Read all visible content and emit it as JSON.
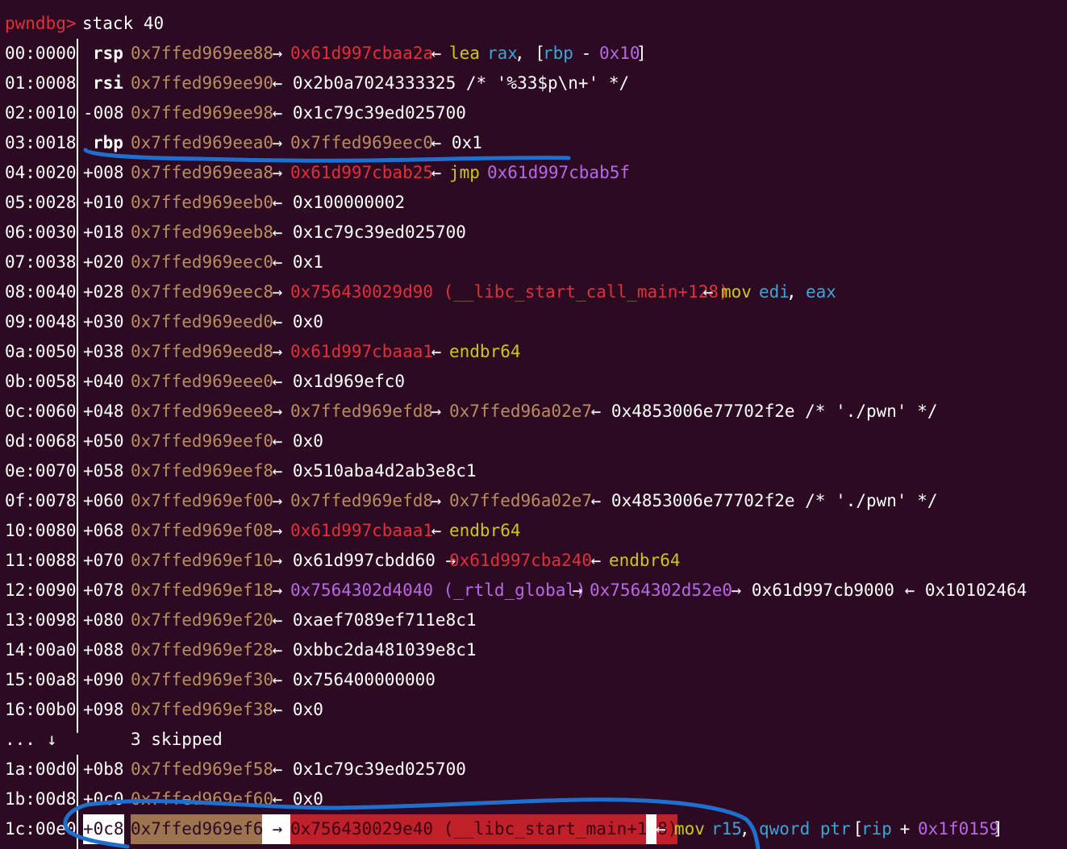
{
  "terminal": {
    "prompt": "pwndbg>",
    "command": "stack 40",
    "skipped": {
      "dots": "...",
      "arrow": "↓",
      "text": "3 skipped"
    },
    "colors": {
      "background": "#2c0a22",
      "prompt": "#e0303a",
      "stack_addr": "#b98d62",
      "code_ptr": "#e0303a",
      "instruction": "#c8c820",
      "register": "#3ea4d8",
      "data_ptr": "#b768e8",
      "annotation": "#1f6fd0"
    },
    "rows": [
      {
        "idx": "00:0000",
        "off": "rsp",
        "off_bold": true,
        "parts": [
          {
            "t": "0x7ffed969ee88",
            "c": "brown"
          },
          {
            "t": " → ",
            "c": "white"
          },
          {
            "t": "0x61d997cbaa2a",
            "c": "red"
          },
          {
            "t": " ← ",
            "c": "white"
          },
          {
            "t": "lea",
            "c": "yellow"
          },
          {
            "t": " ",
            "c": "white"
          },
          {
            "t": "rax",
            "c": "blue"
          },
          {
            "t": ", [",
            "c": "white"
          },
          {
            "t": "rbp",
            "c": "blue"
          },
          {
            "t": " - ",
            "c": "white"
          },
          {
            "t": "0x10",
            "c": "purple"
          },
          {
            "t": "]",
            "c": "white"
          }
        ]
      },
      {
        "idx": "01:0008",
        "off": "rsi",
        "off_bold": true,
        "parts": [
          {
            "t": "0x7ffed969ee90",
            "c": "brown"
          },
          {
            "t": " ← 0x2b0a7024333325 /* '%33$p\\n+' */",
            "c": "white"
          }
        ]
      },
      {
        "idx": "02:0010",
        "off": "-008",
        "parts": [
          {
            "t": "0x7ffed969ee98",
            "c": "brown"
          },
          {
            "t": " ← 0x1c79c39ed025700",
            "c": "white"
          }
        ]
      },
      {
        "idx": "03:0018",
        "off": "rbp",
        "off_bold": true,
        "parts": [
          {
            "t": "0x7ffed969eea0",
            "c": "brown"
          },
          {
            "t": " → ",
            "c": "white"
          },
          {
            "t": "0x7ffed969eec0",
            "c": "brown"
          },
          {
            "t": " ← 0x1",
            "c": "white"
          }
        ]
      },
      {
        "idx": "04:0020",
        "off": "+008",
        "parts": [
          {
            "t": "0x7ffed969eea8",
            "c": "brown"
          },
          {
            "t": " → ",
            "c": "white"
          },
          {
            "t": "0x61d997cbab25",
            "c": "red"
          },
          {
            "t": " ← ",
            "c": "white"
          },
          {
            "t": "jmp",
            "c": "yellow"
          },
          {
            "t": " ",
            "c": "white"
          },
          {
            "t": "0x61d997cbab5f",
            "c": "purple"
          }
        ]
      },
      {
        "idx": "05:0028",
        "off": "+010",
        "parts": [
          {
            "t": "0x7ffed969eeb0",
            "c": "brown"
          },
          {
            "t": " ← 0x100000002",
            "c": "white"
          }
        ]
      },
      {
        "idx": "06:0030",
        "off": "+018",
        "parts": [
          {
            "t": "0x7ffed969eeb8",
            "c": "brown"
          },
          {
            "t": " ← 0x1c79c39ed025700",
            "c": "white"
          }
        ]
      },
      {
        "idx": "07:0038",
        "off": "+020",
        "parts": [
          {
            "t": "0x7ffed969eec0",
            "c": "brown"
          },
          {
            "t": " ← 0x1",
            "c": "white"
          }
        ]
      },
      {
        "idx": "08:0040",
        "off": "+028",
        "parts": [
          {
            "t": "0x7ffed969eec8",
            "c": "brown"
          },
          {
            "t": " → ",
            "c": "white"
          },
          {
            "t": "0x756430029d90 (__libc_start_call_main+128)",
            "c": "red"
          },
          {
            "t": " ← ",
            "c": "white"
          },
          {
            "t": "mov",
            "c": "yellow"
          },
          {
            "t": " ",
            "c": "white"
          },
          {
            "t": "edi",
            "c": "blue"
          },
          {
            "t": ", ",
            "c": "white"
          },
          {
            "t": "eax",
            "c": "blue"
          }
        ]
      },
      {
        "idx": "09:0048",
        "off": "+030",
        "parts": [
          {
            "t": "0x7ffed969eed0",
            "c": "brown"
          },
          {
            "t": " ← 0x0",
            "c": "white"
          }
        ]
      },
      {
        "idx": "0a:0050",
        "off": "+038",
        "parts": [
          {
            "t": "0x7ffed969eed8",
            "c": "brown"
          },
          {
            "t": " → ",
            "c": "white"
          },
          {
            "t": "0x61d997cbaaa1",
            "c": "red"
          },
          {
            "t": " ← ",
            "c": "white"
          },
          {
            "t": "endbr64",
            "c": "yellow"
          }
        ]
      },
      {
        "idx": "0b:0058",
        "off": "+040",
        "parts": [
          {
            "t": "0x7ffed969eee0",
            "c": "brown"
          },
          {
            "t": " ← 0x1d969efc0",
            "c": "white"
          }
        ]
      },
      {
        "idx": "0c:0060",
        "off": "+048",
        "parts": [
          {
            "t": "0x7ffed969eee8",
            "c": "brown"
          },
          {
            "t": " → ",
            "c": "white"
          },
          {
            "t": "0x7ffed969efd8",
            "c": "brown"
          },
          {
            "t": " → ",
            "c": "white"
          },
          {
            "t": "0x7ffed96a02e7",
            "c": "brown"
          },
          {
            "t": " ← 0x4853006e77702f2e /* './pwn' */",
            "c": "white"
          }
        ]
      },
      {
        "idx": "0d:0068",
        "off": "+050",
        "parts": [
          {
            "t": "0x7ffed969eef0",
            "c": "brown"
          },
          {
            "t": " ← 0x0",
            "c": "white"
          }
        ]
      },
      {
        "idx": "0e:0070",
        "off": "+058",
        "parts": [
          {
            "t": "0x7ffed969eef8",
            "c": "brown"
          },
          {
            "t": " ← 0x510aba4d2ab3e8c1",
            "c": "white"
          }
        ]
      },
      {
        "idx": "0f:0078",
        "off": "+060",
        "parts": [
          {
            "t": "0x7ffed969ef00",
            "c": "brown"
          },
          {
            "t": " → ",
            "c": "white"
          },
          {
            "t": "0x7ffed969efd8",
            "c": "brown"
          },
          {
            "t": " → ",
            "c": "white"
          },
          {
            "t": "0x7ffed96a02e7",
            "c": "brown"
          },
          {
            "t": " ← 0x4853006e77702f2e /* './pwn' */",
            "c": "white"
          }
        ]
      },
      {
        "idx": "10:0080",
        "off": "+068",
        "parts": [
          {
            "t": "0x7ffed969ef08",
            "c": "brown"
          },
          {
            "t": " → ",
            "c": "white"
          },
          {
            "t": "0x61d997cbaaa1",
            "c": "red"
          },
          {
            "t": " ← ",
            "c": "white"
          },
          {
            "t": "endbr64",
            "c": "yellow"
          }
        ]
      },
      {
        "idx": "11:0088",
        "off": "+070",
        "parts": [
          {
            "t": "0x7ffed969ef10",
            "c": "brown"
          },
          {
            "t": " → 0x61d997cbdd60 → ",
            "c": "white"
          },
          {
            "t": "0x61d997cba240",
            "c": "red"
          },
          {
            "t": " ← ",
            "c": "white"
          },
          {
            "t": "endbr64",
            "c": "yellow"
          }
        ]
      },
      {
        "idx": "12:0090",
        "off": "+078",
        "parts": [
          {
            "t": "0x7ffed969ef18",
            "c": "brown"
          },
          {
            "t": " → ",
            "c": "white"
          },
          {
            "t": "0x7564302d4040 (_rtld_global)",
            "c": "purple"
          },
          {
            "t": " → ",
            "c": "white"
          },
          {
            "t": "0x7564302d52e0",
            "c": "purple"
          },
          {
            "t": " → 0x61d997cb9000 ← 0x10102464",
            "c": "white"
          }
        ]
      },
      {
        "idx": "13:0098",
        "off": "+080",
        "parts": [
          {
            "t": "0x7ffed969ef20",
            "c": "brown"
          },
          {
            "t": " ← 0xaef7089ef711e8c1",
            "c": "white"
          }
        ]
      },
      {
        "idx": "14:00a0",
        "off": "+088",
        "parts": [
          {
            "t": "0x7ffed969ef28",
            "c": "brown"
          },
          {
            "t": " ← 0xbbc2da481039e8c1",
            "c": "white"
          }
        ]
      },
      {
        "idx": "15:00a8",
        "off": "+090",
        "parts": [
          {
            "t": "0x7ffed969ef30",
            "c": "brown"
          },
          {
            "t": " ← 0x756400000000",
            "c": "white"
          }
        ]
      },
      {
        "idx": "16:00b0",
        "off": "+098",
        "parts": [
          {
            "t": "0x7ffed969ef38",
            "c": "brown"
          },
          {
            "t": " ← 0x0",
            "c": "white"
          }
        ]
      },
      {
        "skipped": true
      },
      {
        "idx": "1a:00d0",
        "off": "+0b8",
        "parts": [
          {
            "t": "0x7ffed969ef58",
            "c": "brown"
          },
          {
            "t": " ← 0x1c79c39ed025700",
            "c": "white"
          }
        ]
      },
      {
        "idx": "1b:00d8",
        "off": "+0c0",
        "parts": [
          {
            "t": "0x7ffed969ef60",
            "c": "brown"
          },
          {
            "t": " ← 0x0",
            "c": "white"
          }
        ]
      },
      {
        "idx": "1c:00e0",
        "off": "+0c8",
        "off_hl": "white",
        "parts": [
          {
            "t": "0x7ffed969ef68",
            "c": "hl-brown"
          },
          {
            "t": " → ",
            "c": "hl-white"
          },
          {
            "t": "0x756430029e40 (__libc_start_main+128)",
            "c": "hl-red"
          },
          {
            "t": " ",
            "c": "hl-white"
          },
          {
            "t": "← ",
            "c": "white"
          },
          {
            "t": "mov",
            "c": "yellow"
          },
          {
            "t": " ",
            "c": "white"
          },
          {
            "t": "r15",
            "c": "blue"
          },
          {
            "t": ", ",
            "c": "white"
          },
          {
            "t": "qword ptr",
            "c": "blue"
          },
          {
            "t": " [",
            "c": "white"
          },
          {
            "t": "rip",
            "c": "blue"
          },
          {
            "t": " + ",
            "c": "white"
          },
          {
            "t": "0x1f0159",
            "c": "purple"
          },
          {
            "t": "]",
            "c": "white"
          }
        ]
      }
    ]
  }
}
